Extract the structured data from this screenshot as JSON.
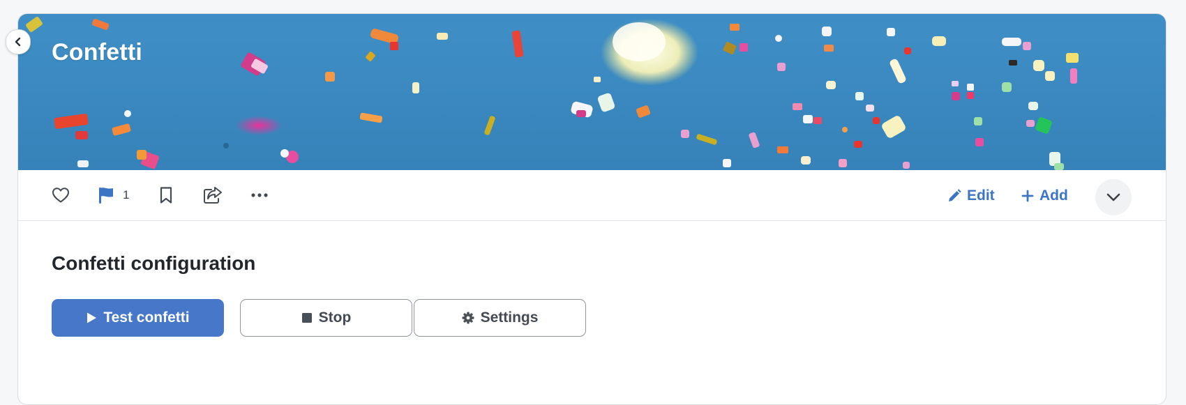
{
  "banner": {
    "title": "Confetti"
  },
  "toolbar": {
    "flag_count": "1",
    "edit_label": "Edit",
    "add_label": "Add"
  },
  "config": {
    "title": "Confetti configuration",
    "test_label": "Test confetti",
    "stop_label": "Stop",
    "settings_label": "Settings"
  },
  "icons": {
    "back": "chevron-left-icon",
    "like": "heart-icon",
    "flag": "flag-icon",
    "bookmark": "bookmark-icon",
    "share": "share-icon",
    "more": "more-dots-icon",
    "edit": "pencil-icon",
    "add": "plus-icon",
    "collapse": "chevron-down-icon",
    "play": "play-icon",
    "stop": "stop-icon",
    "settings": "gear-icon"
  },
  "colors": {
    "accent": "#3c75c4",
    "primary_button": "#4677c8",
    "banner_sky": "#3a88bf",
    "heading": "#23272c"
  }
}
